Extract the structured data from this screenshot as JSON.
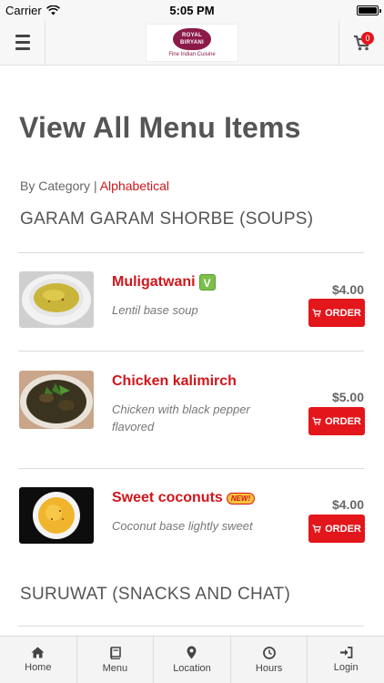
{
  "status_bar": {
    "carrier": "Carrier",
    "time": "5:05 PM"
  },
  "header": {
    "logo_line1": "ROYAL",
    "logo_line2": "BIRYANI",
    "logo_tagline": "Fine Indian Cuisine",
    "cart_count": "0"
  },
  "page": {
    "title": "View All Menu Items",
    "sort_by_category": "By Category",
    "sort_separator": "|",
    "sort_alphabetical": "Alphabetical"
  },
  "sections": [
    {
      "title": "GARAM GARAM SHORBE (SOUPS)",
      "items": [
        {
          "name": "Muligatwani",
          "badge": "veg",
          "badge_text": "V",
          "description": "Lentil base soup",
          "price": "$4.00",
          "order_label": "ORDER"
        },
        {
          "name": "Chicken kalimirch",
          "badge": "",
          "badge_text": "",
          "description": "Chicken with black pepper flavored",
          "price": "$5.00",
          "order_label": "ORDER"
        },
        {
          "name": "Sweet coconuts",
          "badge": "new",
          "badge_text": "NEW!",
          "description": "Coconut base lightly sweet",
          "price": "$4.00",
          "order_label": "ORDER"
        }
      ]
    },
    {
      "title": "SURUWAT (SNACKS AND CHAT)",
      "items": []
    }
  ],
  "tabbar": [
    {
      "label": "Home",
      "icon": "home-icon"
    },
    {
      "label": "Menu",
      "icon": "book-icon"
    },
    {
      "label": "Location",
      "icon": "map-marker-icon"
    },
    {
      "label": "Hours",
      "icon": "clock-icon"
    },
    {
      "label": "Login",
      "icon": "sign-in-icon"
    }
  ],
  "colors": {
    "accent": "#e3161b",
    "link": "#d0161b",
    "veg": "#7cc04a",
    "new_badge": "#f6c43a"
  }
}
